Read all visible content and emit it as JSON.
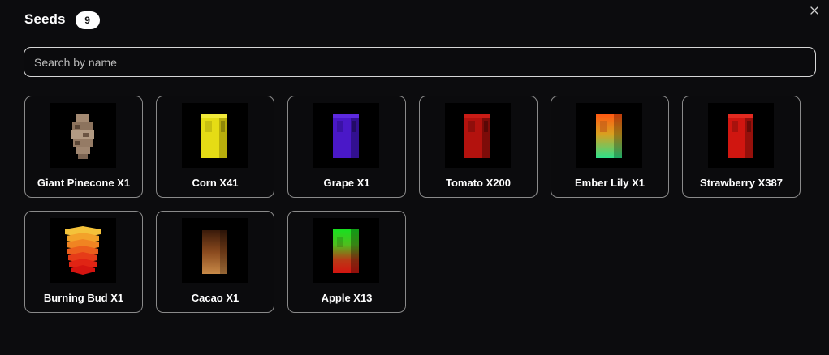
{
  "header": {
    "title": "Seeds",
    "count": "9"
  },
  "search": {
    "placeholder": "Search by name",
    "value": ""
  },
  "seeds": [
    {
      "label": "Giant Pinecone X1",
      "icon": "giant-pinecone-seed-icon"
    },
    {
      "label": "Corn X41",
      "icon": "corn-seed-icon"
    },
    {
      "label": "Grape X1",
      "icon": "grape-seed-icon"
    },
    {
      "label": "Tomato X200",
      "icon": "tomato-seed-icon"
    },
    {
      "label": "Ember Lily X1",
      "icon": "ember-lily-seed-icon"
    },
    {
      "label": "Strawberry X387",
      "icon": "strawberry-seed-icon"
    },
    {
      "label": "Burning Bud X1",
      "icon": "burning-bud-seed-icon"
    },
    {
      "label": "Cacao X1",
      "icon": "cacao-seed-icon"
    },
    {
      "label": "Apple X13",
      "icon": "apple-seed-icon"
    }
  ],
  "colors": {
    "background": "#0c0c0e",
    "card_border": "#8a8a8a",
    "text": "#ffffff"
  }
}
